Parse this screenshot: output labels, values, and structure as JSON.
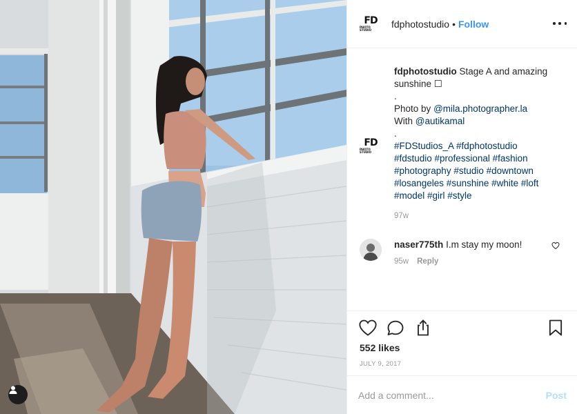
{
  "header": {
    "username": "fdphotostudio",
    "separator": "•",
    "follow_label": "Follow",
    "avatar_text": "FD",
    "avatar_subtext": "PHOTO STUDIO",
    "more_icon": "more-options-icon"
  },
  "caption": {
    "username": "fdphotostudio",
    "title": "Stage A and amazing sunshine ☐",
    "dot1": ".",
    "photo_by_label": "Photo by",
    "photo_by_handle": "@mila.photographer.la",
    "with_label": "With",
    "with_handle": "@autikamal",
    "dot2": ".",
    "hashtags_1": "#FDStudios_A #fdphotostudio",
    "hashtags_2": "#fdstudio #professional #fashion",
    "hashtags_3": "#photography #studio #downtown",
    "hashtags_4": "#losangeles #sunshine #white #loft",
    "hashtags_5": "#model #girl #style",
    "time": "97w"
  },
  "comment": {
    "username": "naser775th",
    "text": "I.m stay my moon!",
    "time": "95w",
    "reply_label": "Reply"
  },
  "actions": {
    "likes": "552 likes",
    "date": "JULY 9, 2017"
  },
  "add_comment": {
    "placeholder": "Add a comment...",
    "post_label": "Post"
  }
}
